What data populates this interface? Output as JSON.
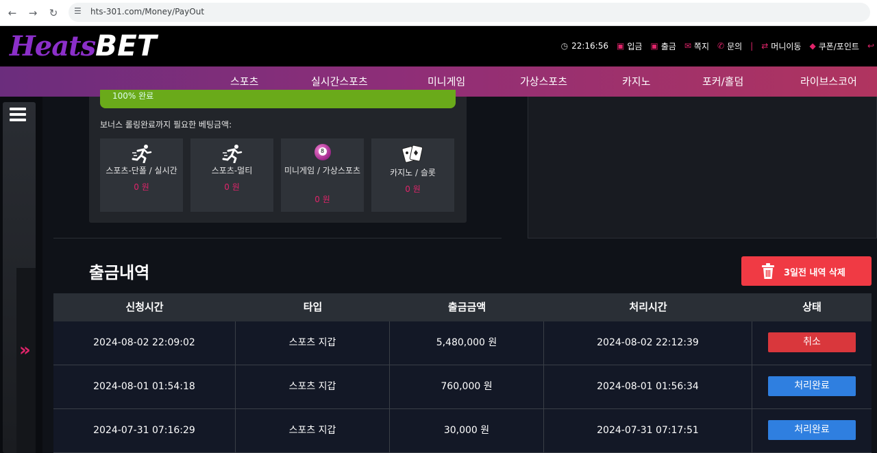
{
  "browser": {
    "url": "hts-301.com/Money/PayOut"
  },
  "header": {
    "logo_a": "Heats",
    "logo_b": "BET",
    "time": "22:16:56",
    "links": [
      "입금",
      "출금",
      "쪽지",
      "문의",
      "머니이동",
      "쿠폰/포인트"
    ]
  },
  "menu": [
    "스포츠",
    "실시간스포츠",
    "미니게임",
    "가상스포츠",
    "카지노",
    "포커/홀덤",
    "라이브스코어"
  ],
  "bonus": {
    "progress_text": "100% 완료",
    "label": "보너스 롤링완료까지 필요한 베팅금액:",
    "cards": [
      {
        "name": "스포츠-단폴 / 실시간",
        "value": "0 원",
        "icon": "runner-icon"
      },
      {
        "name": "스포츠-멀티",
        "value": "0 원",
        "icon": "runner-icon"
      },
      {
        "name": "미니게임 / 가상스포츠",
        "value": "0 원",
        "icon": "billiard-ball-icon"
      },
      {
        "name": "카지노 / 슬롯",
        "value": "0 원",
        "icon": "cards-icon"
      }
    ]
  },
  "history": {
    "title": "출금내역",
    "delete_button": "3일전 내역 삭제",
    "columns": [
      "신청시간",
      "타입",
      "출금금액",
      "처리시간",
      "상태"
    ],
    "rows": [
      {
        "requested": "2024-08-02 22:09:02",
        "type": "스포츠 지갑",
        "amount": "5,480,000 원",
        "processed": "2024-08-02 22:12:39",
        "status": "취소",
        "status_color": "#d9373c"
      },
      {
        "requested": "2024-08-01 01:54:18",
        "type": "스포츠 지갑",
        "amount": "760,000 원",
        "processed": "2024-08-01 01:56:34",
        "status": "처리완료",
        "status_color": "#2f7fe0"
      },
      {
        "requested": "2024-07-31 07:16:29",
        "type": "스포츠 지갑",
        "amount": "30,000 원",
        "processed": "2024-07-31 07:17:51",
        "status": "처리완료",
        "status_color": "#2f7fe0"
      }
    ]
  },
  "colors": {
    "accent": "#e0246a",
    "menu_gradient_start": "#6b2d7d",
    "menu_gradient_end": "#b0345f",
    "progress": "#6aaa1a",
    "delete": "#f03a44"
  }
}
